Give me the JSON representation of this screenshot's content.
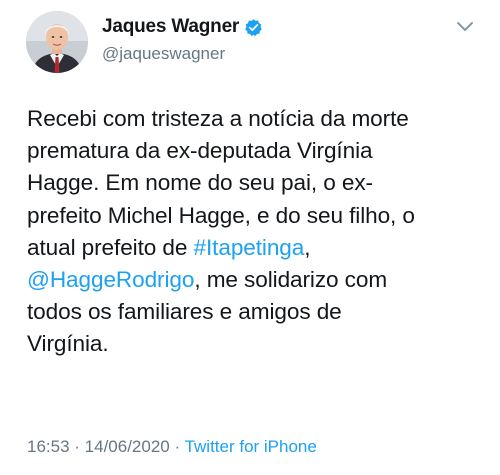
{
  "author": {
    "name": "Jaques Wagner",
    "handle": "@jaqueswagner",
    "verified": true,
    "avatar_icon": "profile-photo"
  },
  "tweet": {
    "lines": [
      [
        {
          "text": "Recebi com tristeza a notícia da morte",
          "link": false
        }
      ],
      [
        {
          "text": "prematura da ex-deputada Virgínia",
          "link": false
        }
      ],
      [
        {
          "text": "Hagge. Em nome do seu pai, o ex-",
          "link": false
        }
      ],
      [
        {
          "text": "prefeito Michel Hagge, e do seu filho, o",
          "link": false
        }
      ],
      [
        {
          "text": "atual prefeito de ",
          "link": false
        },
        {
          "text": "#Itapetinga",
          "link": true
        },
        {
          "text": ",",
          "link": false
        }
      ],
      [
        {
          "text": "@HaggeRodrigo",
          "link": true
        },
        {
          "text": ", me solidarizo com",
          "link": false
        }
      ],
      [
        {
          "text": "todos os familiares e amigos de",
          "link": false
        }
      ],
      [
        {
          "text": "Virgínia.",
          "link": false
        }
      ]
    ]
  },
  "meta": {
    "time": "16:53",
    "sep1": " · ",
    "date": "14/06/2020",
    "sep2": " · ",
    "source": "Twitter for iPhone"
  },
  "colors": {
    "link": "#1da1f2",
    "secondary_text": "#657786",
    "primary_text": "#14171a",
    "verified_badge": "#1da1f2"
  },
  "icons": {
    "menu": "chevron-down-icon",
    "verified": "verified-badge-icon"
  }
}
